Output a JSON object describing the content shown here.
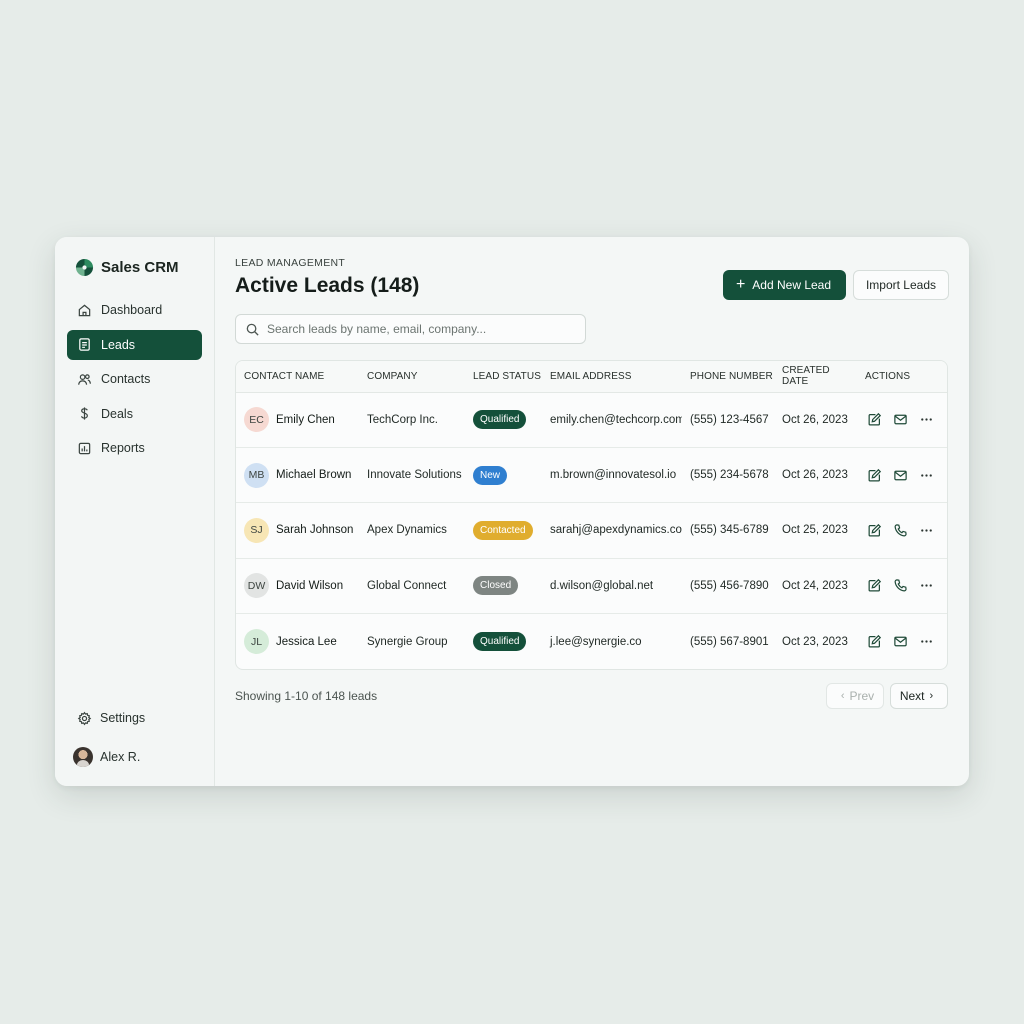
{
  "app": {
    "name": "Sales CRM",
    "brand_color": "#14503a"
  },
  "sidebar": {
    "items": [
      {
        "label": "Dashboard",
        "icon": "home-icon",
        "active": false
      },
      {
        "label": "Leads",
        "icon": "document-icon",
        "active": true
      },
      {
        "label": "Contacts",
        "icon": "users-icon",
        "active": false
      },
      {
        "label": "Deals",
        "icon": "dollar-icon",
        "active": false
      },
      {
        "label": "Reports",
        "icon": "bar-chart-icon",
        "active": false
      }
    ],
    "settings_label": "Settings",
    "user_name": "Alex R."
  },
  "header": {
    "eyebrow": "LEAD MANAGEMENT",
    "title": "Active Leads (148)",
    "add_button": "Add New Lead",
    "import_button": "Import Leads"
  },
  "search": {
    "placeholder": "Search leads by name, email, company..."
  },
  "table": {
    "columns": [
      "CONTACT NAME",
      "COMPANY",
      "LEAD STATUS",
      "EMAIL ADDRESS",
      "PHONE NUMBER",
      "CREATED DATE",
      "ACTIONS"
    ],
    "rows": [
      {
        "initials": "EC",
        "avatar_color": "#f6d9d2",
        "name": "Emily Chen",
        "company": "TechCorp Inc.",
        "status": "Qualified",
        "status_color": "#14503a",
        "email": "emily.chen@techcorp.com",
        "phone": "(555) 123-4567",
        "created": "Oct 26, 2023",
        "contact_action": "mail-icon"
      },
      {
        "initials": "MB",
        "avatar_color": "#cfe0f3",
        "name": "Michael Brown",
        "company": "Innovate Solutions",
        "status": "New",
        "status_color": "#2f7fd0",
        "email": "m.brown@innovatesol.io",
        "phone": "(555) 234-5678",
        "created": "Oct 26, 2023",
        "contact_action": "mail-icon"
      },
      {
        "initials": "SJ",
        "avatar_color": "#f7e6b5",
        "name": "Sarah Johnson",
        "company": "Apex Dynamics",
        "status": "Contacted",
        "status_color": "#e0ad2e",
        "email": "sarahj@apexdynamics.co",
        "phone": "(555) 345-6789",
        "created": "Oct 25, 2023",
        "contact_action": "phone-icon"
      },
      {
        "initials": "DW",
        "avatar_color": "#e2e4e3",
        "name": "David Wilson",
        "company": "Global Connect",
        "status": "Closed",
        "status_color": "#7e8582",
        "email": "d.wilson@global.net",
        "phone": "(555) 456-7890",
        "created": "Oct 24, 2023",
        "contact_action": "phone-icon"
      },
      {
        "initials": "JL",
        "avatar_color": "#d5ecd9",
        "name": "Jessica Lee",
        "company": "Synergie Group",
        "status": "Qualified",
        "status_color": "#14503a",
        "email": "j.lee@synergie.co",
        "phone": "(555) 567-8901",
        "created": "Oct 23, 2023",
        "contact_action": "mail-icon"
      }
    ]
  },
  "footer": {
    "showing": "Showing 1-10 of 148 leads",
    "prev": "Prev",
    "next": "Next"
  }
}
